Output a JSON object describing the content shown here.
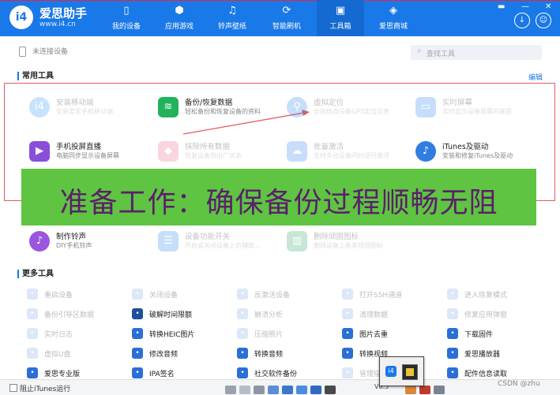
{
  "app": {
    "title": "爱思助手",
    "url": "www.i4.cn",
    "logo": "i4"
  },
  "nav": [
    {
      "label": "我的设备",
      "icon": "phone-icon"
    },
    {
      "label": "应用游戏",
      "icon": "cube-icon"
    },
    {
      "label": "铃声壁纸",
      "icon": "music-file-icon"
    },
    {
      "label": "智能刷机",
      "icon": "refresh-gear-icon"
    },
    {
      "label": "工具箱",
      "icon": "toolbox-icon",
      "active": true
    },
    {
      "label": "爱思商城",
      "icon": "shopping-bag-icon"
    }
  ],
  "status": {
    "device": "未连接设备"
  },
  "search": {
    "placeholder": "查找工具"
  },
  "common": {
    "title": "常用工具",
    "edit": "编辑"
  },
  "tools": [
    {
      "name": "安装移动端",
      "desc": "安装爱思手机移动端",
      "icon": "i4-mobile-icon",
      "color": "#3a9df2",
      "dim": true
    },
    {
      "name": "备份/恢复数据",
      "desc": "轻松备份和恢复设备的资料",
      "icon": "layers-icon",
      "color": "#21b35c",
      "dim": false
    },
    {
      "name": "虚拟定位",
      "desc": "全局修改设备GPS定位信息",
      "icon": "location-pin-icon",
      "color": "#3a8df2",
      "dim": true
    },
    {
      "name": "实时屏幕",
      "desc": "实时显示设备屏幕的画面",
      "icon": "screen-icon",
      "color": "#3a8df2",
      "dim": true
    },
    {
      "name": "手机投屏直播",
      "desc": "电脑同步显示设备屏幕",
      "icon": "cast-screen-icon",
      "color": "#8a4fd8",
      "dim": false
    },
    {
      "name": "抹除所有数据",
      "desc": "恢复设备到出厂状态",
      "icon": "eraser-icon",
      "color": "#f06c8a",
      "dim": true
    },
    {
      "name": "批量激活",
      "desc": "支持多台设备同时进行激活",
      "icon": "cloud-icon",
      "color": "#3a8df2",
      "dim": true
    },
    {
      "name": "iTunes及驱动",
      "desc": "安装和修复iTunes及驱动",
      "icon": "itunes-icon",
      "color": "#2f7de3",
      "dim": false
    },
    {
      "name": "制作铃声",
      "desc": "DIY手机铃声",
      "icon": "ringtone-icon",
      "color": "#9b55e0",
      "dim": false
    },
    {
      "name": "设备功能开关",
      "desc": "开启或关闭设备上的辅助...",
      "icon": "sliders-icon",
      "color": "#3a8df2",
      "dim": true
    },
    {
      "name": "删除顽固图标",
      "desc": "删除设备上各类顽固图标",
      "icon": "trash-icon",
      "color": "#3aa86a",
      "dim": true
    }
  ],
  "banner": "准备工作：确保备份过程顺畅无阻",
  "more": {
    "title": "更多工具",
    "items": [
      {
        "label": "重启设备",
        "icon": "restart-icon",
        "color": "#8fb5e8",
        "dim": true
      },
      {
        "label": "关闭设备",
        "icon": "power-icon",
        "color": "#8fb5e8",
        "dim": true
      },
      {
        "label": "反激活设备",
        "icon": "deactivate-icon",
        "color": "#8fb5e8",
        "dim": true
      },
      {
        "label": "打开SSH通道",
        "icon": "ssh-icon",
        "color": "#8fb5e8",
        "dim": true
      },
      {
        "label": "进入恢复模式",
        "icon": "recovery-icon",
        "color": "#8fb5e8",
        "dim": true
      },
      {
        "label": "备份引导区数据",
        "icon": "boot-backup-icon",
        "color": "#8fb5e8",
        "dim": true
      },
      {
        "label": "破解时间限额",
        "icon": "clock-icon",
        "color": "#1e4f9b",
        "dim": false
      },
      {
        "label": "崩溃分析",
        "icon": "crash-icon",
        "color": "#8fb5e8",
        "dim": true
      },
      {
        "label": "清理数据",
        "icon": "clean-icon",
        "color": "#8fb5e8",
        "dim": true
      },
      {
        "label": "修复应用弹窗",
        "icon": "repair-icon",
        "color": "#8fb5e8",
        "dim": true
      },
      {
        "label": "实时日志",
        "icon": "log-icon",
        "color": "#8fb5e8",
        "dim": true
      },
      {
        "label": "转换HEIC图片",
        "icon": "heic-icon",
        "color": "#2b6fd6",
        "dim": false
      },
      {
        "label": "压缩照片",
        "icon": "compress-icon",
        "color": "#8fb5e8",
        "dim": true
      },
      {
        "label": "图片去重",
        "icon": "dedupe-icon",
        "color": "#2b6fd6",
        "dim": false
      },
      {
        "label": "下载固件",
        "icon": "firmware-icon",
        "color": "#2b6fd6",
        "dim": false
      },
      {
        "label": "虚拟U盘",
        "icon": "usb-icon",
        "color": "#8fb5e8",
        "dim": true
      },
      {
        "label": "修改音频",
        "icon": "audio-edit-icon",
        "color": "#2b6fd6",
        "dim": false
      },
      {
        "label": "转换音频",
        "icon": "audio-convert-icon",
        "color": "#2b6fd6",
        "dim": false
      },
      {
        "label": "转换视频",
        "icon": "video-convert-icon",
        "color": "#2b6fd6",
        "dim": false
      },
      {
        "label": "爱思播放器",
        "icon": "player-icon",
        "color": "#2b6fd6",
        "dim": false
      },
      {
        "label": "爱思专业版",
        "icon": "i4-pro-icon",
        "color": "#2b6fd6",
        "dim": false
      },
      {
        "label": "IPA签名",
        "icon": "ipa-icon",
        "color": "#2b6fd6",
        "dim": false
      },
      {
        "label": "社交软件备份",
        "icon": "social-backup-icon",
        "color": "#2b6fd6",
        "dim": false
      },
      {
        "label": "管理描述文件",
        "icon": "profile-icon",
        "color": "#8fb5e8",
        "dim": true
      },
      {
        "label": "配件信息读取",
        "icon": "accessory-icon",
        "color": "#2b6fd6",
        "dim": false
      }
    ]
  },
  "footer": {
    "itunes_checkbox": "阻止iTunes运行",
    "version": "V8.3",
    "watermark": "CSDN @zhu"
  },
  "colors": {
    "accent": "#1a79e8",
    "banner_bg": "#5ec442",
    "banner_text": "#5b1f6a",
    "highlight_border": "#e85a5a"
  }
}
